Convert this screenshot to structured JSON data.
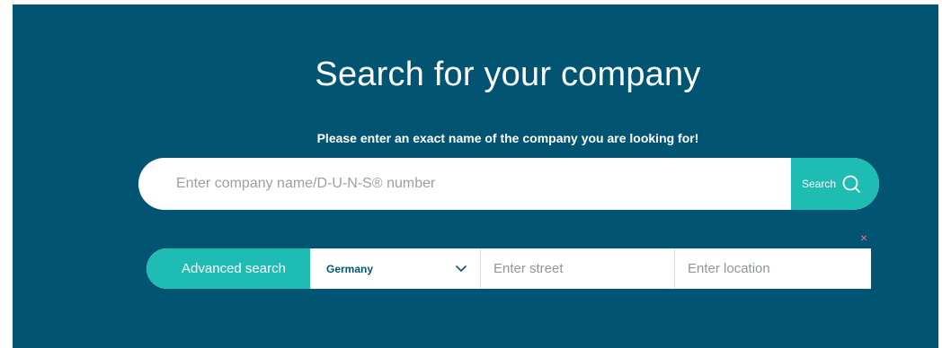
{
  "heading": {
    "title": "Search for your company",
    "subtitle": "Please enter an exact name of the company you are looking for!"
  },
  "search": {
    "placeholder": "Enter company name/D-U-N-S® number",
    "button_label": "Search",
    "button_icon": "search-icon"
  },
  "advanced": {
    "button_label": "Advanced search",
    "country": "Germany",
    "street_placeholder": "Enter street",
    "location_placeholder": "Enter location",
    "close_symbol": "×"
  },
  "colors": {
    "background": "#015572",
    "accent": "#1fbcb3",
    "close": "#e0708a"
  }
}
